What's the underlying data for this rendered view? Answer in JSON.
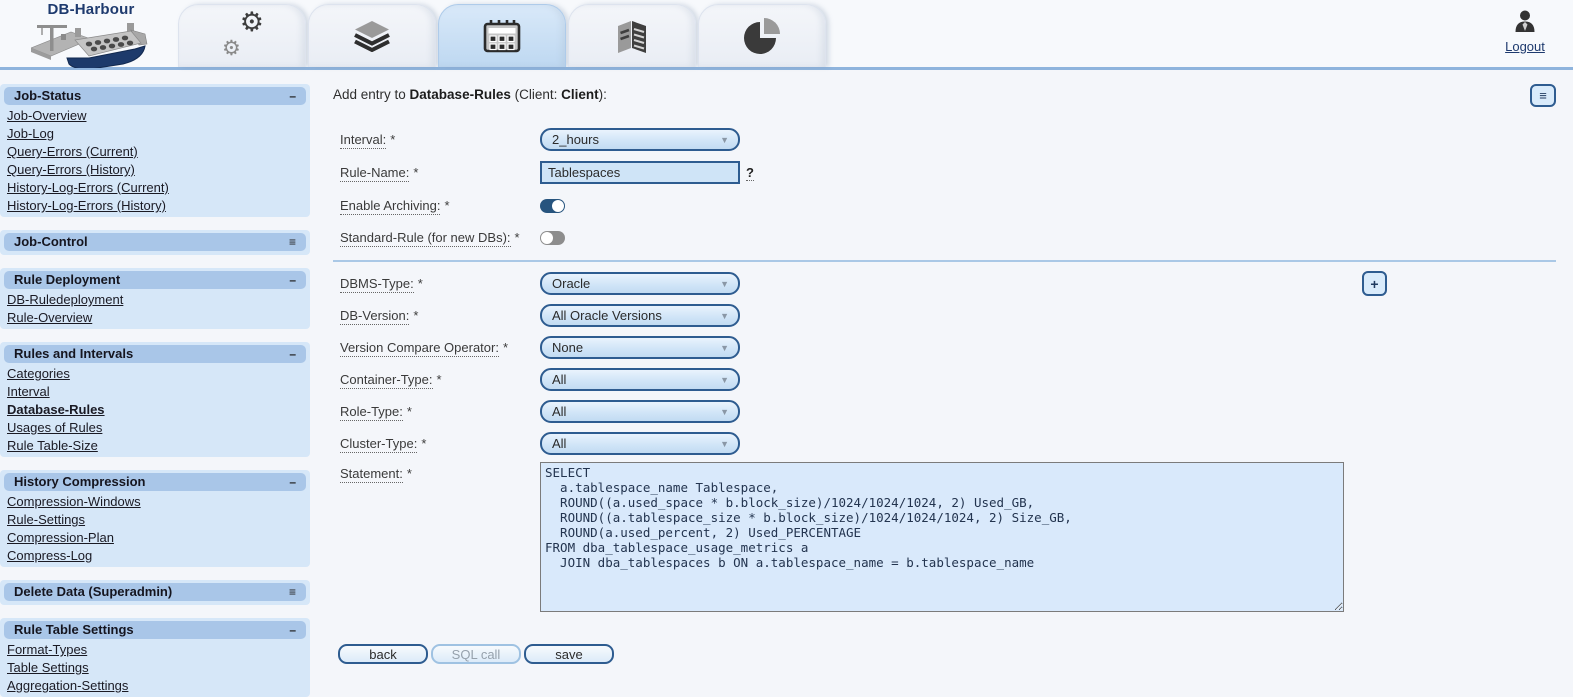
{
  "colors": {
    "page_bg": "#f4f6fa",
    "header_line": "#8fb4dd",
    "navy": "#1e3a6e",
    "accent": "#2e5c90",
    "control_bg": "#cfe4f7",
    "textarea_bg": "#d9e9fb",
    "section_header_bg": "#a9c6e8",
    "section_bg": "#d6e7f8",
    "toggle_on": "#27547e",
    "toggle_off": "#8d8d8d",
    "link": "#1a1a24",
    "disabled_text": "#96a1ac"
  },
  "header": {
    "logo_text": "DB-Harbour",
    "logout_label": "Logout",
    "tabs": [
      {
        "icon": "gears-icon",
        "active": false
      },
      {
        "icon": "layers-icon",
        "active": false
      },
      {
        "icon": "calendar-icon",
        "active": true
      },
      {
        "icon": "report-icon",
        "active": false
      },
      {
        "icon": "pie-chart-icon",
        "active": false
      }
    ]
  },
  "sidebar": {
    "sections": [
      {
        "title": "Job-Status",
        "glyph": "–",
        "items": [
          "Job-Overview",
          "Job-Log",
          "Query-Errors (Current)",
          "Query-Errors (History)",
          "History-Log-Errors (Current)",
          "History-Log-Errors (History)"
        ]
      },
      {
        "title": "Job-Control",
        "glyph": "≡",
        "items": []
      },
      {
        "title": "Rule Deployment",
        "glyph": "–",
        "items": [
          "DB-Ruledeployment",
          "Rule-Overview"
        ]
      },
      {
        "title": "Rules and Intervals",
        "glyph": "–",
        "active_item": "Database-Rules",
        "items": [
          "Categories",
          "Interval",
          "Database-Rules",
          "Usages of Rules",
          "Rule Table-Size"
        ]
      },
      {
        "title": "History Compression",
        "glyph": "–",
        "items": [
          "Compression-Windows",
          "Rule-Settings",
          "Compression-Plan",
          "Compress-Log"
        ]
      },
      {
        "title": "Delete Data (Superadmin)",
        "glyph": "≡",
        "items": []
      },
      {
        "title": "Rule Table Settings",
        "glyph": "–",
        "items": [
          "Format-Types",
          "Table Settings",
          "Aggregation-Settings"
        ]
      }
    ]
  },
  "main": {
    "title": {
      "prefix": "Add entry to ",
      "entity": "Database-Rules",
      "mid": " (Client: ",
      "client": "Client",
      "suffix": "):"
    },
    "menu_button_label": "≡",
    "add_button_label": "+",
    "fields": {
      "interval": {
        "label": "Interval:",
        "required": "*",
        "value": "2_hours"
      },
      "rule_name": {
        "label": "Rule-Name:",
        "required": "*",
        "value": "Tablespaces",
        "help": "?"
      },
      "enable_archiving": {
        "label": "Enable Archiving:",
        "required": "*",
        "on": true
      },
      "standard_rule": {
        "label": "Standard-Rule (for new DBs):",
        "required": "*",
        "on": false
      },
      "dbms_type": {
        "label": "DBMS-Type:",
        "required": "*",
        "value": "Oracle"
      },
      "db_version": {
        "label": "DB-Version:",
        "required": "*",
        "value": "All Oracle Versions"
      },
      "version_compare": {
        "label": "Version Compare Operator:",
        "required": "*",
        "value": "None"
      },
      "container_type": {
        "label": "Container-Type:",
        "required": "*",
        "value": "All"
      },
      "role_type": {
        "label": "Role-Type:",
        "required": "*",
        "value": "All"
      },
      "cluster_type": {
        "label": "Cluster-Type:",
        "required": "*",
        "value": "All"
      },
      "statement": {
        "label": "Statement:",
        "required": "*",
        "value": "SELECT\n  a.tablespace_name Tablespace,\n  ROUND((a.used_space * b.block_size)/1024/1024/1024, 2) Used_GB,\n  ROUND((a.tablespace_size * b.block_size)/1024/1024/1024, 2) Size_GB,\n  ROUND(a.used_percent, 2) Used_PERCENTAGE\nFROM dba_tablespace_usage_metrics a\n  JOIN dba_tablespaces b ON a.tablespace_name = b.tablespace_name"
      }
    },
    "buttons": {
      "back": "back",
      "sql_call": "SQL call",
      "save": "save"
    }
  }
}
